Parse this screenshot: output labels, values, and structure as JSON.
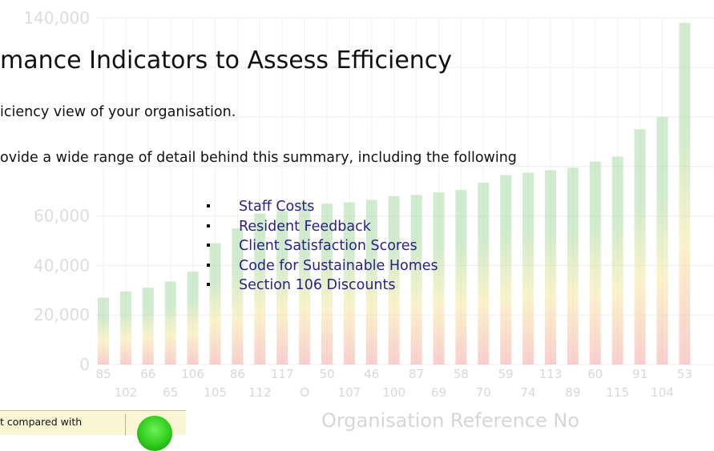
{
  "page": {
    "top_line_fragment": "· · · ·   · ·   ·   ·   · · · · · · · · · ·   · · · · · · · · · · · · · · · · · · ·",
    "heading": "mance Indicators to Assess Efficiency",
    "paragraph1": "iciency view of your organisation.",
    "paragraph2": "ovide a wide range of detail behind this summary, including the following",
    "bullets": [
      "Staff Costs",
      "Resident Feedback",
      "Client Satisfaction Scores",
      "Code for Sustainable Homes",
      "Section 106 Discounts"
    ],
    "comparison_label": "t compared with",
    "comparison_indicator_color": "#2fcc1c"
  },
  "chart_data": {
    "type": "bar",
    "xlabel": "Organisation Reference No",
    "ylabel": "",
    "ylim": [
      0,
      140000
    ],
    "y_ticks": [
      "0",
      "20,000",
      "40,000",
      "60,000",
      "140,000"
    ],
    "categories": [
      "85",
      "102",
      "66",
      "65",
      "106",
      "105",
      "86",
      "112",
      "117",
      "O",
      "50",
      "107",
      "46",
      "100",
      "87",
      "69",
      "58",
      "70",
      "59",
      "74",
      "113",
      "89",
      "60",
      "115",
      "91",
      "104",
      "53"
    ],
    "values": [
      27000,
      29500,
      31000,
      33500,
      37500,
      49000,
      55000,
      61000,
      62000,
      65000,
      65000,
      65500,
      66500,
      68000,
      68500,
      69500,
      70500,
      73500,
      76500,
      77500,
      78500,
      79500,
      82000,
      84000,
      95000,
      100000,
      138000
    ],
    "bar_gradient": [
      "#f4a7a7",
      "#f6e9a0",
      "#a9dba6"
    ],
    "grid": true
  }
}
